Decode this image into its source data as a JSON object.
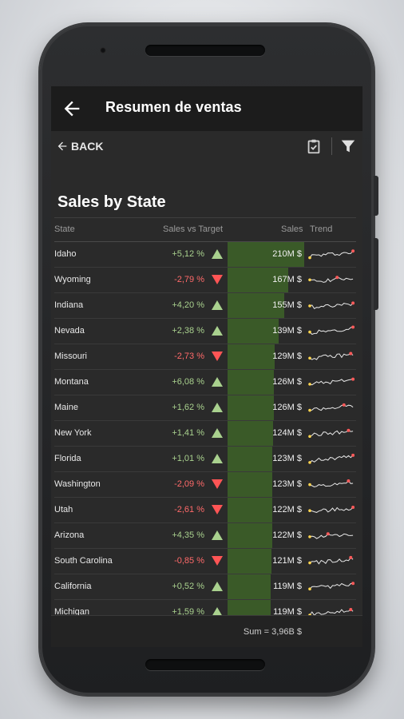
{
  "app_bar": {
    "title": "Resumen de ventas"
  },
  "toolbar": {
    "back_label": "BACK",
    "icons": [
      "clipboard-check-icon",
      "filter-icon"
    ]
  },
  "heading": "Sales by State",
  "columns": {
    "state": "State",
    "vs_target": "Sales vs Target",
    "sales": "Sales",
    "trend": "Trend"
  },
  "colors": {
    "positive": "#a9d18e",
    "negative": "#ff6a6a",
    "bar": "#3a5a28",
    "arrow_up": "#a9d18e",
    "arrow_down": "#ff5555"
  },
  "rows": [
    {
      "state": "Idaho",
      "vs_target": "+5,12 %",
      "direction": "up",
      "sales": "210M $",
      "sales_value": 210
    },
    {
      "state": "Wyoming",
      "vs_target": "-2,79 %",
      "direction": "down",
      "sales": "167M $",
      "sales_value": 167
    },
    {
      "state": "Indiana",
      "vs_target": "+4,20 %",
      "direction": "up",
      "sales": "155M $",
      "sales_value": 155
    },
    {
      "state": "Nevada",
      "vs_target": "+2,38 %",
      "direction": "up",
      "sales": "139M $",
      "sales_value": 139
    },
    {
      "state": "Missouri",
      "vs_target": "-2,73 %",
      "direction": "down",
      "sales": "129M $",
      "sales_value": 129
    },
    {
      "state": "Montana",
      "vs_target": "+6,08 %",
      "direction": "up",
      "sales": "126M $",
      "sales_value": 126
    },
    {
      "state": "Maine",
      "vs_target": "+1,62 %",
      "direction": "up",
      "sales": "126M $",
      "sales_value": 126
    },
    {
      "state": "New York",
      "vs_target": "+1,41 %",
      "direction": "up",
      "sales": "124M $",
      "sales_value": 124
    },
    {
      "state": "Florida",
      "vs_target": "+1,01 %",
      "direction": "up",
      "sales": "123M $",
      "sales_value": 123
    },
    {
      "state": "Washington",
      "vs_target": "-2,09 %",
      "direction": "down",
      "sales": "123M $",
      "sales_value": 123
    },
    {
      "state": "Utah",
      "vs_target": "-2,61 %",
      "direction": "down",
      "sales": "122M $",
      "sales_value": 122
    },
    {
      "state": "Arizona",
      "vs_target": "+4,35 %",
      "direction": "up",
      "sales": "122M $",
      "sales_value": 122
    },
    {
      "state": "South Carolina",
      "vs_target": "-0,85 %",
      "direction": "down",
      "sales": "121M $",
      "sales_value": 121
    },
    {
      "state": "California",
      "vs_target": "+0,52 %",
      "direction": "up",
      "sales": "119M $",
      "sales_value": 119
    },
    {
      "state": "Michigan",
      "vs_target": "+1,59 %",
      "direction": "up",
      "sales": "119M $",
      "sales_value": 119
    }
  ],
  "footer": {
    "sum": "Sum = 3,96B $"
  }
}
